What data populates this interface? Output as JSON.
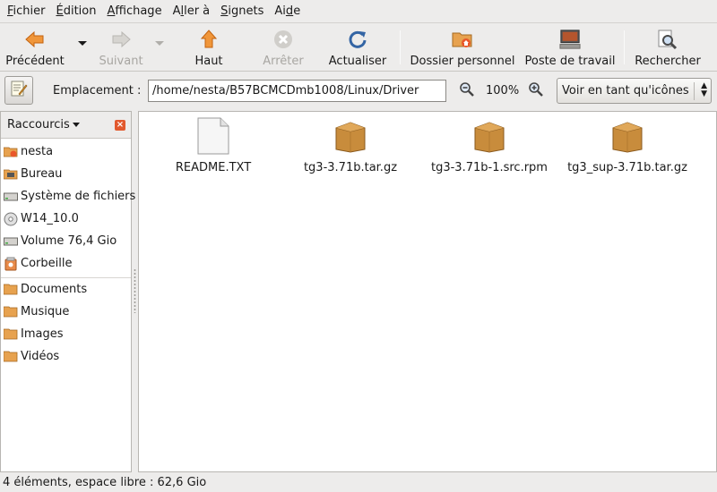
{
  "menu": {
    "items": [
      {
        "pre": "",
        "acc": "F",
        "post": "ichier"
      },
      {
        "pre": "",
        "acc": "É",
        "post": "dition"
      },
      {
        "pre": "",
        "acc": "A",
        "post": "ffichage"
      },
      {
        "pre": "A",
        "acc": "l",
        "post": "ler à"
      },
      {
        "pre": "",
        "acc": "S",
        "post": "ignets"
      },
      {
        "pre": "Ai",
        "acc": "d",
        "post": "e"
      }
    ]
  },
  "toolbar": {
    "back": "Précédent",
    "forward": "Suivant",
    "up": "Haut",
    "stop": "Arrêter",
    "reload": "Actualiser",
    "home": "Dossier personnel",
    "desktop": "Poste de travail",
    "search": "Rechercher"
  },
  "location": {
    "label": "Emplacement :",
    "path": "/home/nesta/B57BCMCDmb1008/Linux/Driver",
    "zoom": "100%",
    "view_mode": "Voir en tant qu'icônes"
  },
  "sidebar": {
    "title": "Raccourcis",
    "items": [
      {
        "label": "nesta",
        "icon": "home-folder-icon"
      },
      {
        "label": "Bureau",
        "icon": "desktop-icon"
      },
      {
        "label": "Système de fichiers",
        "icon": "drive-icon"
      },
      {
        "label": "W14_10.0",
        "icon": "cdrom-icon"
      },
      {
        "label": "Volume 76,4 Gio",
        "icon": "drive-icon"
      },
      {
        "label": "Corbeille",
        "icon": "trash-icon"
      },
      {
        "label": "Documents",
        "icon": "folder-icon"
      },
      {
        "label": "Musique",
        "icon": "folder-icon"
      },
      {
        "label": "Images",
        "icon": "folder-icon"
      },
      {
        "label": "Vidéos",
        "icon": "folder-icon"
      }
    ]
  },
  "files": [
    {
      "name": "README.TXT",
      "icon": "text-file-icon"
    },
    {
      "name": "tg3-3.71b.tar.gz",
      "icon": "archive-icon"
    },
    {
      "name": "tg3-3.71b-1.src.rpm",
      "icon": "archive-icon"
    },
    {
      "name": "tg3_sup-3.71b.tar.gz",
      "icon": "archive-icon"
    }
  ],
  "status": "4 éléments, espace libre : 62,6 Gio",
  "colors": {
    "accent_orange": "#e98b2b",
    "reload_blue": "#3465a4",
    "background": "#edeceb"
  }
}
